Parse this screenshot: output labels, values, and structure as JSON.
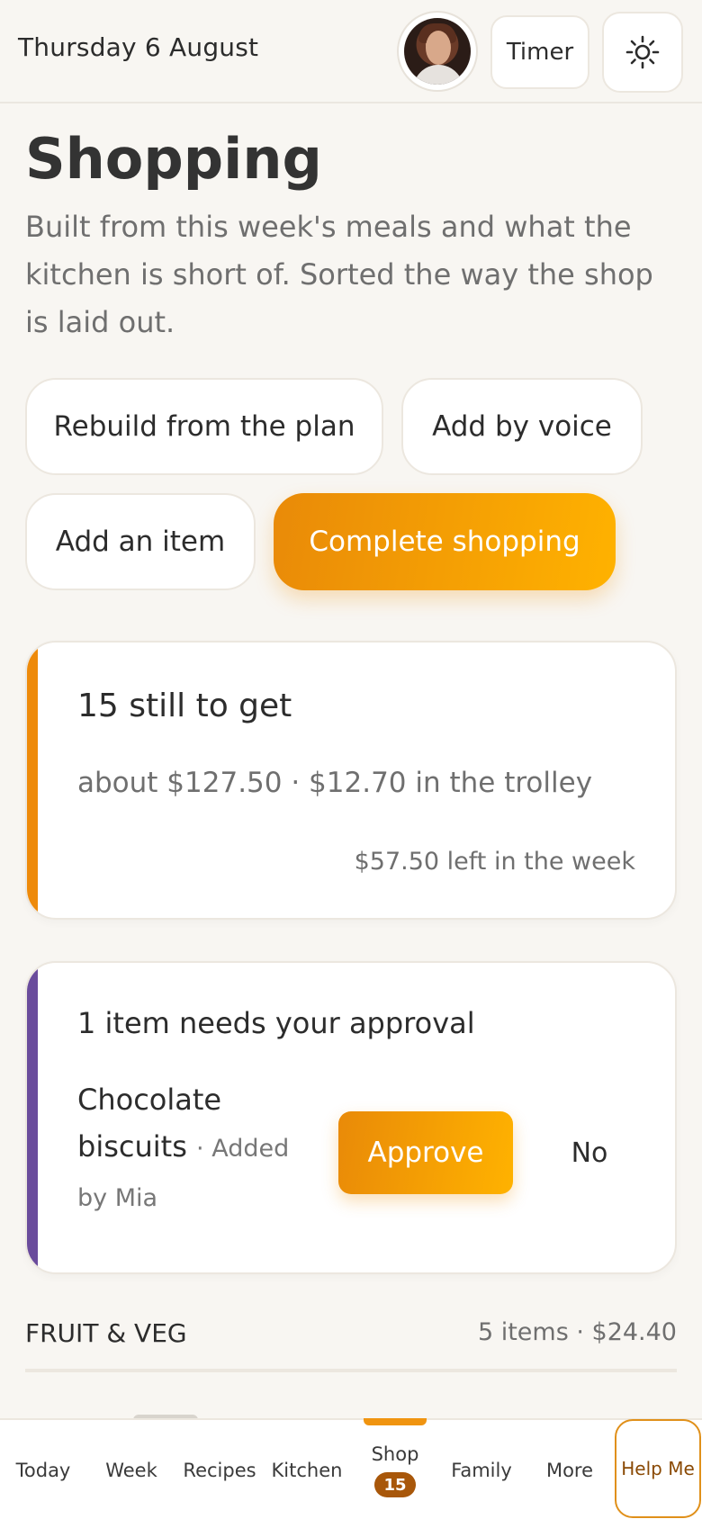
{
  "header": {
    "date": "Thursday 6 August",
    "timer_label": "Timer"
  },
  "page": {
    "title": "Shopping",
    "intro": "Built from this week's meals and what the kitchen is short of. Sorted the way the shop is laid out."
  },
  "actions": {
    "rebuild": "Rebuild from the plan",
    "voice": "Add by voice",
    "add_item": "Add an item",
    "complete": "Complete shopping"
  },
  "summary": {
    "main": "15 still to get",
    "sub": "about $127.50 · $12.70 in the trolley",
    "left": "$57.50 left in the week",
    "accent_color": "#ee8a0a"
  },
  "approval": {
    "title": "1 item needs your approval",
    "item_name": "Chocolate biscuits",
    "item_meta": "· Added by Mia",
    "approve_label": "Approve",
    "no_label": "No",
    "accent_color": "#6a4c9c"
  },
  "section": {
    "name": "FRUIT & VEG",
    "meta": "5 items · $24.40"
  },
  "nav": {
    "items": [
      {
        "label": "Today"
      },
      {
        "label": "Week"
      },
      {
        "label": "Recipes"
      },
      {
        "label": "Kitchen"
      },
      {
        "label": "Shop",
        "badge": "15"
      },
      {
        "label": "Family"
      },
      {
        "label": "More"
      }
    ],
    "help": "Help Me"
  },
  "colors": {
    "accent": "#f09410",
    "badge": "#a8570a",
    "background": "#f8f6f2"
  }
}
